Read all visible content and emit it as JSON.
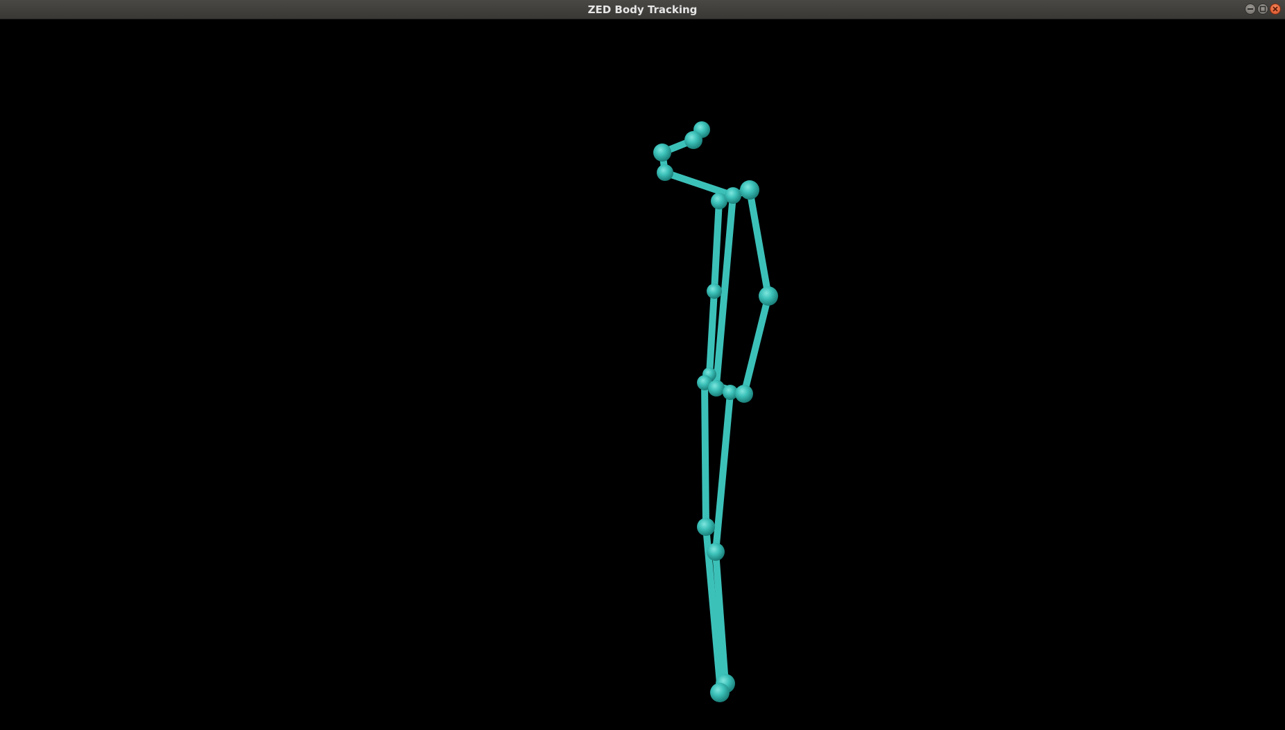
{
  "window": {
    "title": "ZED Body Tracking",
    "buttons": {
      "minimize": "minimize-icon",
      "maximize": "maximize-icon",
      "close": "close-icon"
    }
  },
  "viewport": {
    "background": "#000000",
    "skeleton_color": "#3cc1b9"
  }
}
